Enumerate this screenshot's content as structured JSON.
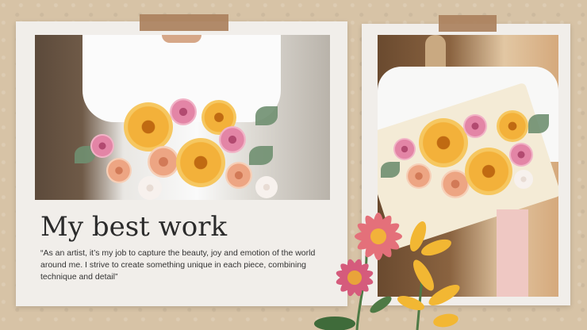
{
  "card": {
    "title": "My best work",
    "quote": "“As an artist, it’s my job to capture the beauty, joy and emotion of the world around me. I strive to create something unique in each piece, combining technique and detail”"
  },
  "colors": {
    "background": "#d7c3a6",
    "card": "#f1eeea",
    "tape": "#ab815d",
    "text": "#2b2b2b"
  },
  "icons": {
    "decorative_flowers": "pink-daisy-and-yellow-lily-illustration"
  }
}
